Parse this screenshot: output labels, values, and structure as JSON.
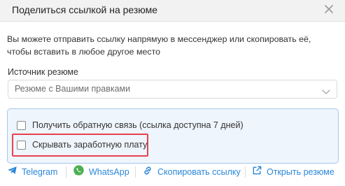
{
  "dialog": {
    "title": "Поделиться ссылкой на резюме",
    "description": "Вы можете отправить ссылку напрямую в мессенджер или скопировать её, чтобы вставить в любое другое место"
  },
  "source": {
    "label": "Источник резюме",
    "value": "Резюме с Вашими правками"
  },
  "options": {
    "feedback_label": "Получить обратную связь (ссылка доступна 7 дней)",
    "feedback_checked": false,
    "hide_salary_label": "Скрывать заработную плату",
    "hide_salary_checked": false
  },
  "actions": {
    "telegram": "Telegram",
    "whatsapp": "WhatsApp",
    "copy": "Скопировать ссылку",
    "open": "Открыть резюме"
  },
  "colors": {
    "accent": "#2a87d8",
    "whatsapp": "#4cb050",
    "highlight": "#e8424f",
    "options_bg": "#eef5fc"
  },
  "icons": [
    "close-icon",
    "chevron-down-icon",
    "telegram-icon",
    "whatsapp-icon",
    "copy-link-icon",
    "external-link-icon"
  ]
}
